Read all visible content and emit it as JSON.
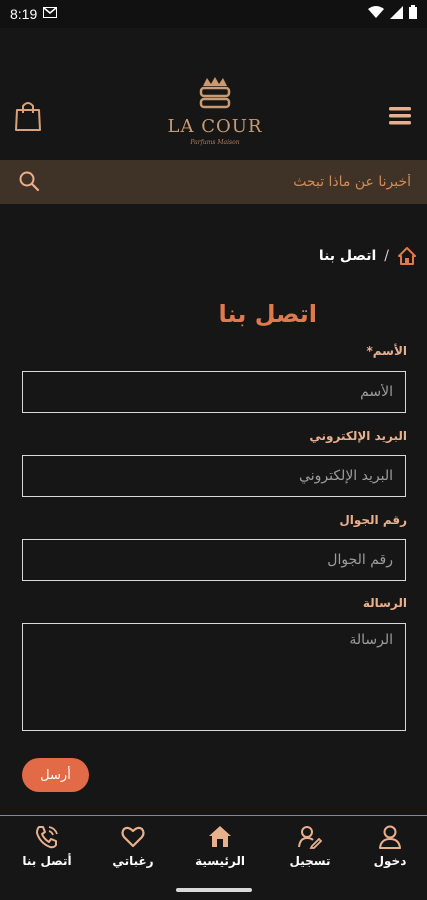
{
  "status_bar": {
    "time": "8:19",
    "icons": [
      "gmail-icon",
      "wifi-icon",
      "signal-icon",
      "battery-icon"
    ]
  },
  "header": {
    "brand": "LA COUR",
    "tagline": "Parfums Maison",
    "icons": {
      "cart": "shopping-bag-icon",
      "menu": "hamburger-menu-icon"
    }
  },
  "search": {
    "placeholder": "أخبرنا عن ماذا تبحث",
    "icon": "search-icon"
  },
  "breadcrumb": {
    "home_icon": "home-icon",
    "separator": "/",
    "current": "اتصل بنا"
  },
  "page": {
    "title": "اتصل بنا"
  },
  "form": {
    "name": {
      "label": "الأسم*",
      "placeholder": "الأسم"
    },
    "email": {
      "label": "البريد الإلكتروني",
      "placeholder": "البريد الإلكتروني"
    },
    "phone": {
      "label": "رقم الجوال",
      "placeholder": "رقم الجوال"
    },
    "message": {
      "label": "الرسالة",
      "placeholder": "الرسالة"
    },
    "submit_label": "أرسل"
  },
  "bottom_nav": {
    "items": [
      {
        "label": "أتصل بنا",
        "icon": "phone-icon"
      },
      {
        "label": "رغباتي",
        "icon": "heart-icon"
      },
      {
        "label": "الرئيسية",
        "icon": "home-icon"
      },
      {
        "label": "تسجيل",
        "icon": "add-user-icon"
      },
      {
        "label": "دخول",
        "icon": "user-icon"
      }
    ]
  },
  "colors": {
    "accent": "#e26a47",
    "label": "#e9b08d",
    "search_bg": "#3f3226",
    "background": "#161616"
  }
}
